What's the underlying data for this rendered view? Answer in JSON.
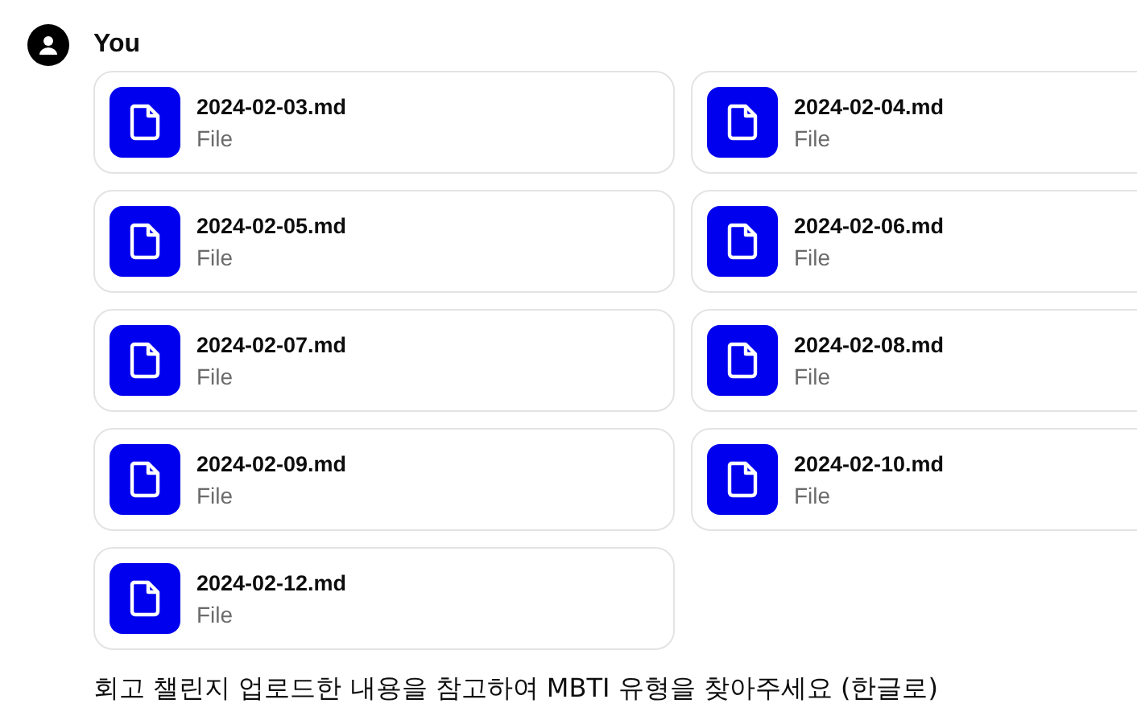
{
  "message": {
    "author": "You",
    "attachments": [
      {
        "name": "2024-02-03.md",
        "type": "File"
      },
      {
        "name": "2024-02-04.md",
        "type": "File"
      },
      {
        "name": "2024-02-05.md",
        "type": "File"
      },
      {
        "name": "2024-02-06.md",
        "type": "File"
      },
      {
        "name": "2024-02-07.md",
        "type": "File"
      },
      {
        "name": "2024-02-08.md",
        "type": "File"
      },
      {
        "name": "2024-02-09.md",
        "type": "File"
      },
      {
        "name": "2024-02-10.md",
        "type": "File"
      },
      {
        "name": "2024-02-12.md",
        "type": "File"
      }
    ],
    "text": "회고 챌린지 업로드한 내용을 참고하여 MBTI 유형을 찾아주세요 (한글로)"
  }
}
